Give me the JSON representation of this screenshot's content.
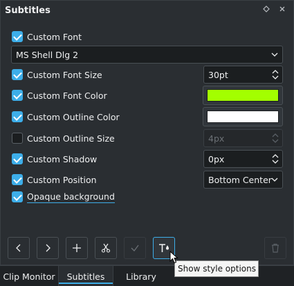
{
  "panel": {
    "title": "Subtitles",
    "title_buttons": {
      "float_icon": "diamond-icon",
      "close_icon": "close-icon"
    }
  },
  "options": {
    "custom_font": {
      "label": "Custom Font",
      "checked": true
    },
    "font_combo": {
      "value": "MS Shell Dlg 2"
    },
    "font_size": {
      "label": "Custom Font Size",
      "checked": true,
      "value": "30pt"
    },
    "font_color": {
      "label": "Custom Font Color",
      "checked": true,
      "color": "#a3ff00"
    },
    "outline_color": {
      "label": "Custom Outline Color",
      "checked": true,
      "color": "#ffffff"
    },
    "outline_size": {
      "label": "Custom Outline Size",
      "checked": false,
      "value": "4px"
    },
    "shadow": {
      "label": "Custom Shadow",
      "checked": true,
      "value": "0px"
    },
    "position": {
      "label": "Custom Position",
      "checked": true,
      "value": "Bottom Center"
    },
    "opaque": {
      "label": "Opaque background",
      "checked": true
    }
  },
  "toolbar": {
    "buttons": [
      "previous-icon",
      "next-icon",
      "add-icon",
      "cut-icon",
      "apply-icon",
      "style-options-icon",
      "delete-icon"
    ]
  },
  "tooltip": {
    "text": "Show style options"
  },
  "tabs": [
    {
      "label": "Clip Monitor",
      "active": false
    },
    {
      "label": "Subtitles",
      "active": true
    },
    {
      "label": "Library",
      "active": false
    }
  ],
  "colors": {
    "accent": "#3daee9",
    "background": "#2a2e32"
  }
}
